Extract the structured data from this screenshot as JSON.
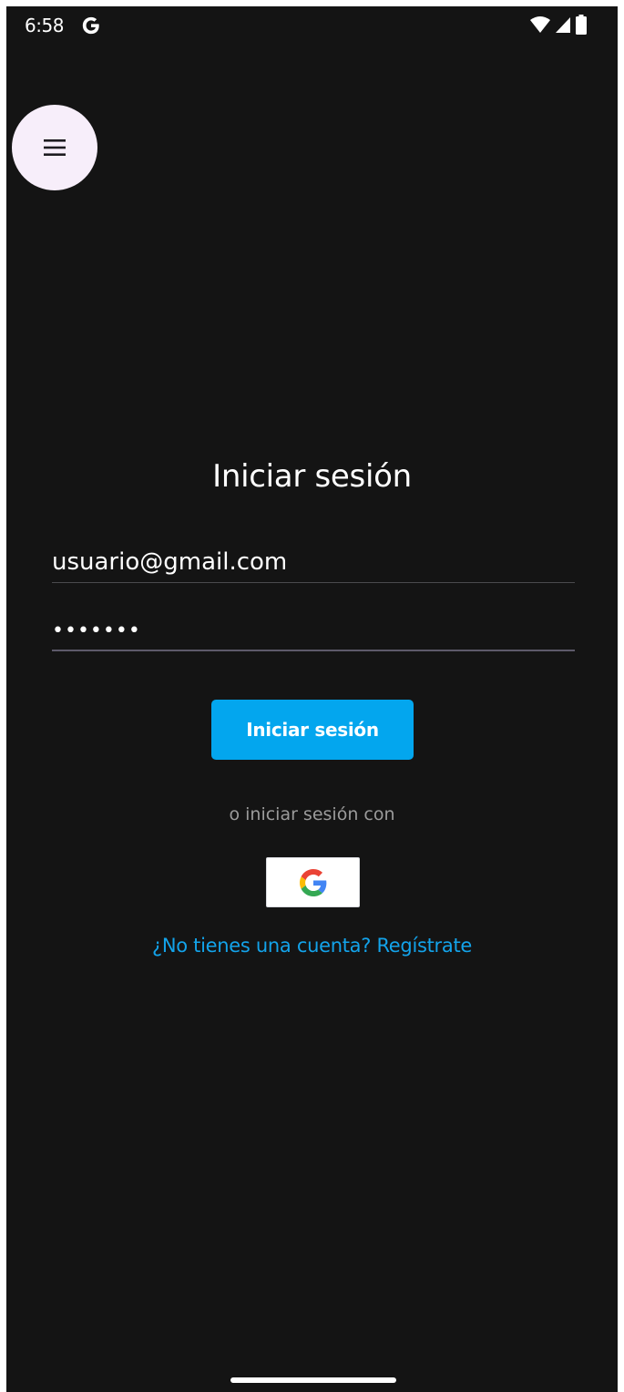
{
  "status_bar": {
    "time": "6:58"
  },
  "login": {
    "title": "Iniciar sesión",
    "email_value": "usuario@gmail.com",
    "password_value": "•••••••",
    "login_button_label": "Iniciar sesión",
    "alt_login_text": "o iniciar sesión con",
    "register_link": "¿No tienes una cuenta? Regístrate"
  },
  "colors": {
    "background": "#141414",
    "accent": "#03a6ee",
    "link": "#13a3ea",
    "menu_button_bg": "#f7eefa"
  }
}
